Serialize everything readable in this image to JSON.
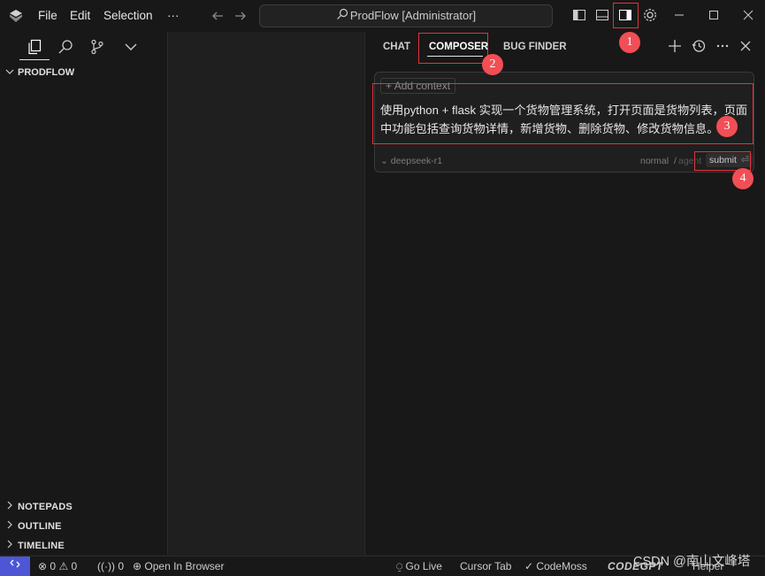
{
  "menu": {
    "file": "File",
    "edit": "Edit",
    "selection": "Selection",
    "more": "···"
  },
  "command_center": {
    "label": "ProdFlow [Administrator]"
  },
  "sidebar": {
    "explorer_title": "PRODFLOW",
    "sections": {
      "notepads": "NOTEPADS",
      "outline": "OUTLINE",
      "timeline": "TIMELINE"
    }
  },
  "panel": {
    "tabs": {
      "chat": "CHAT",
      "composer": "COMPOSER",
      "bug_finder": "BUG FINDER"
    },
    "add_context": "Add context",
    "prompt": "使用python + flask 实现一个货物管理系统，打开页面是货物列表，页面中功能包括查询货物详情，新增货物、删除货物、修改货物信息。",
    "model": "deepseek-r1",
    "mode_normal": "normal",
    "mode_sep": "/",
    "mode_agent": "agent",
    "submit": "submit"
  },
  "annotations": [
    "1",
    "2",
    "3",
    "4"
  ],
  "status": {
    "errors": "0",
    "warnings": "0",
    "ports": "0",
    "open_in_browser": "Open In Browser",
    "go_live": "Go Live",
    "cursor_tab": "Cursor Tab",
    "codemoss": "CodeMoss",
    "codegpt": "CODEGPT",
    "helper": "Helper"
  },
  "watermark": "CSDN @南山文峰塔",
  "colors": {
    "accent": "#4e56d6",
    "annotation": "#e0353d",
    "badge": "#f24e55"
  }
}
